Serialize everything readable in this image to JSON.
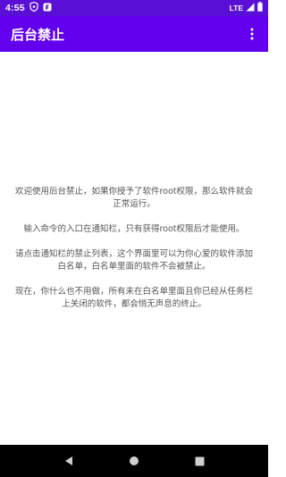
{
  "status_bar": {
    "time": "4:55",
    "network": "LTE",
    "icons": [
      "shield-icon",
      "app-notification-icon",
      "signal-icon",
      "battery-icon"
    ]
  },
  "app_bar": {
    "title": "后台禁止",
    "overflow_icon": "more-vert-icon",
    "color": "#6200ee"
  },
  "content": {
    "paragraphs": [
      "欢迎使用后台禁止，如果你授予了软件root权限，那么软件就会正常运行。",
      "输入命令的入口在通知栏，只有获得root权限后才能使用。",
      "请点击通知栏的禁止列表，这个界面里可以为你心爱的软件添加白名单，白名单里面的软件不会被禁止。",
      "现在，你什么也不用做，所有未在白名单里面且你已经从任务栏上关闭的软件，都会悄无声息的终止。"
    ]
  },
  "nav_bar": {
    "buttons": [
      "back-icon",
      "home-icon",
      "recents-icon"
    ]
  }
}
